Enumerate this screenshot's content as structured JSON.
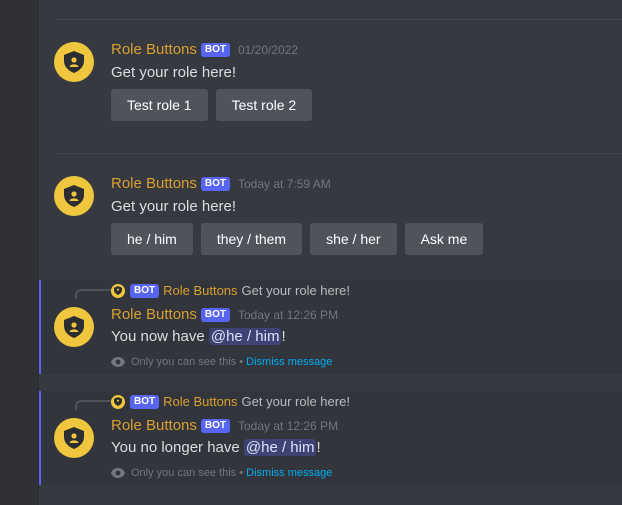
{
  "bot_name": "Role Buttons",
  "bot_tag": "BOT",
  "messages": [
    {
      "timestamp": "01/20/2022",
      "content": "Get your role here!",
      "buttons": [
        "Test role 1",
        "Test role 2"
      ]
    },
    {
      "timestamp": "Today at 7:59 AM",
      "content": "Get your role here!",
      "buttons": [
        "he / him",
        "they / them",
        "she / her",
        "Ask me"
      ]
    },
    {
      "reply_preview": "Get your role here!",
      "timestamp": "Today at 12:26 PM",
      "content_prefix": "You now have ",
      "mention": "@he / him",
      "content_suffix": "!",
      "ephemeral_note": "Only you can see this",
      "separator": " • ",
      "dismiss_label": "Dismiss message"
    },
    {
      "reply_preview": "Get your role here!",
      "timestamp": "Today at 12:26 PM",
      "content_prefix": "You no longer have ",
      "mention": "@he / him",
      "content_suffix": "!",
      "ephemeral_note": "Only you can see this",
      "separator": " • ",
      "dismiss_label": "Dismiss message"
    }
  ],
  "colors": {
    "background": "#36393f",
    "username": "#d8a02e",
    "bot_tag": "#5865f2",
    "button": "#4f545c",
    "link": "#00aff4",
    "avatar": "#f0c63e"
  }
}
